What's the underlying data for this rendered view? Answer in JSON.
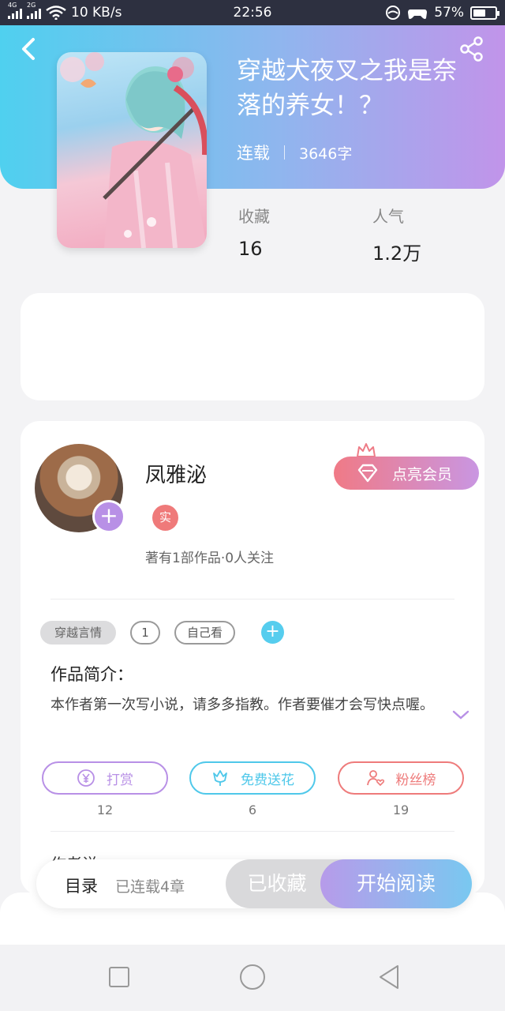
{
  "status_bar": {
    "network_left": "4G",
    "network_right": "2G",
    "speed": "10 KB/s",
    "time": "22:56",
    "battery": "57%",
    "battery_level": 0.57
  },
  "book": {
    "title": "穿越犬夜叉之我是奈落的养女！？",
    "status": "连载",
    "word_count": "3646字",
    "favorites_label": "收藏",
    "favorites_value": "16",
    "popularity_label": "人气",
    "popularity_value": "1.2万"
  },
  "author": {
    "name": "凤雅泌",
    "real_badge": "实",
    "stats": "著有1部作品·0人关注",
    "vip_button": "点亮会员",
    "avatar_plus": "+"
  },
  "tags": {
    "items": [
      "穿越言情",
      "1",
      "自己看"
    ],
    "add": "+"
  },
  "intro": {
    "title": "作品简介：",
    "text": "本作者第一次写小说，请多多指教。作者要催才会写快点喔。"
  },
  "actions": {
    "reward": {
      "label": "打赏",
      "count": "12"
    },
    "flowers": {
      "label": "免费送花",
      "count": "6"
    },
    "fans": {
      "label": "粉丝榜",
      "count": "19"
    }
  },
  "section_peek": "作者说",
  "bottom_bar": {
    "catalog": "目录",
    "chapters": "已连载4章",
    "favorite_button": "已收藏",
    "read_button": "开始阅读"
  },
  "colors": {
    "header_start": "#4fd0ef",
    "header_end": "#c194ea",
    "reward": "#b890e6",
    "flowers": "#4fc8ea",
    "fans": "#ee7b7b",
    "vip": "#f07a86"
  }
}
